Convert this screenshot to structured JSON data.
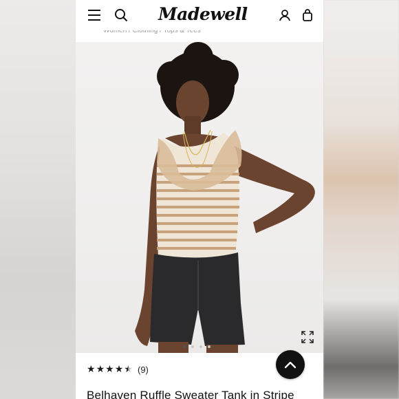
{
  "header": {
    "logo": "Madewell",
    "icons": [
      "menu-icon",
      "search-icon",
      "account-icon",
      "shopping-bag-icon"
    ]
  },
  "breadcrumb": "Women / Clothing / Tops & Tees",
  "gallery": {
    "image_alt": "Model wearing striped ruffle sweater tank and black denim shorts",
    "dots_count": 4,
    "active_dot": 1
  },
  "product": {
    "rating": 4.5,
    "review_count": "(9)",
    "title": "Belhaven Ruffle Sweater Tank in Stripe"
  },
  "colors": {
    "stripe_tan": "#c8a27a",
    "stripe_cream": "#efe6d8",
    "denim": "#2a2a2c",
    "skin": "#6b4430",
    "hair": "#1c1410"
  }
}
